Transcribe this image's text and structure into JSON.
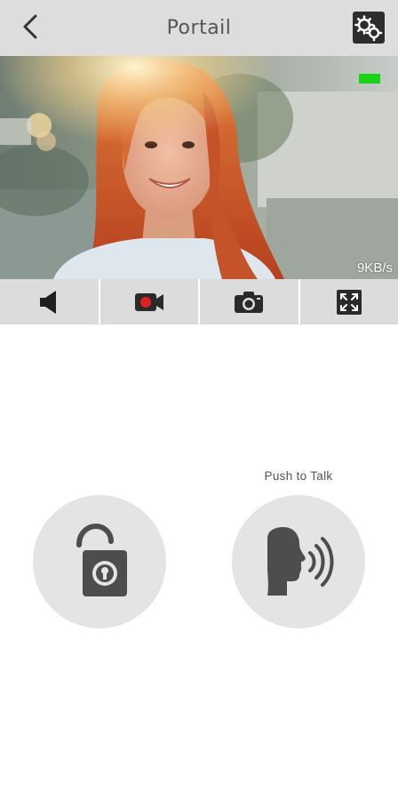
{
  "header": {
    "title": "Portail",
    "back_icon": "chevron-left-icon",
    "settings_icon": "gears-icon"
  },
  "video": {
    "bitrate": "9KB/s",
    "signal_color": "#19d319"
  },
  "toolbar": {
    "items": [
      {
        "icon": "speaker-icon"
      },
      {
        "icon": "record-video-icon",
        "accent": "#e02020"
      },
      {
        "icon": "camera-icon"
      },
      {
        "icon": "fullscreen-icon"
      }
    ]
  },
  "controls": {
    "push_to_talk_label": "Push to Talk",
    "unlock_icon": "unlock-icon",
    "talk_icon": "speaking-head-icon"
  },
  "colors": {
    "bar_background": "#dddddd",
    "button_background": "#e4e4e4",
    "icon_color": "#4d4d4d"
  }
}
